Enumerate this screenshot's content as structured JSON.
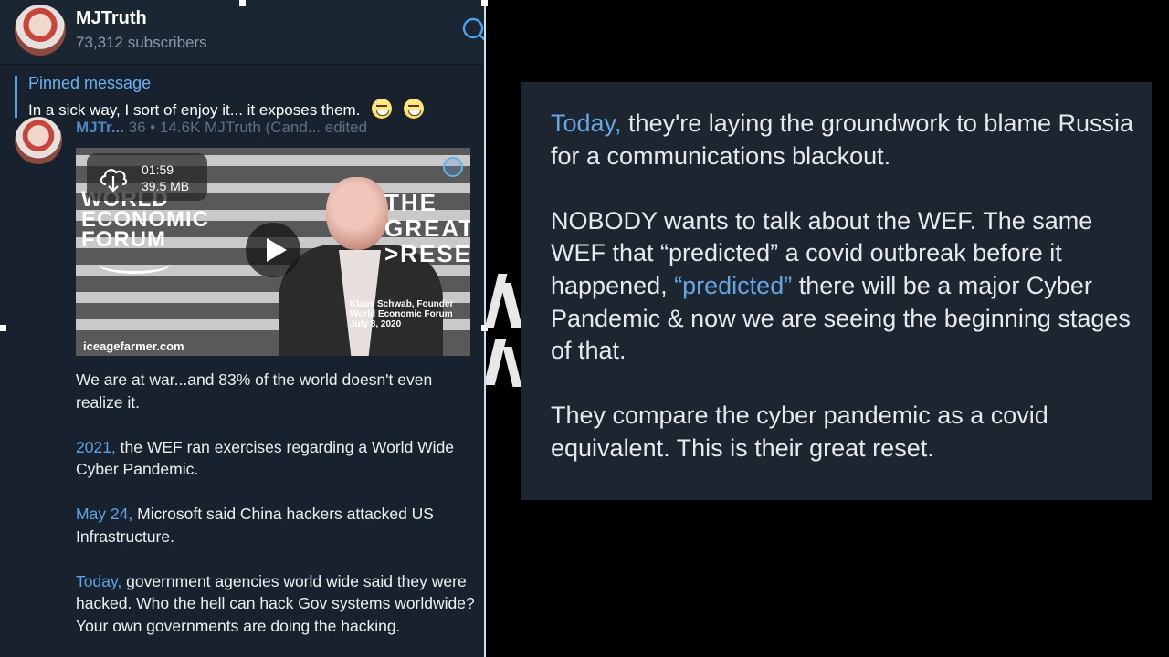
{
  "header": {
    "channel_name": "MJTruth",
    "subscribers": "73,312 subscribers",
    "icon": "search-icon"
  },
  "pinned": {
    "title": "Pinned message",
    "text": "In a sick way, I sort of enjoy it... it exposes them."
  },
  "post": {
    "meta_author": "MJTr...",
    "meta_rest": "36  •  14.6K MJTruth (Cand... edited",
    "video": {
      "duration": "01:59",
      "size": "39.5 MB",
      "logo_lines": [
        "WORLD",
        "ECONOMIC",
        "FORUM"
      ],
      "title_lines": [
        "THE",
        "GREAT",
        ">RESET"
      ],
      "caption_lines": [
        "Klaus Schwab, Founder",
        "World Economic Forum",
        "July 8, 2020"
      ],
      "watermark": "iceagefarmer.com"
    },
    "paragraphs": [
      {
        "highlight": "",
        "text": "We are at war...and 83% of the world doesn't even realize it."
      },
      {
        "highlight": "2021,",
        "text": " the WEF ran exercises regarding a World Wide Cyber Pandemic."
      },
      {
        "highlight": "May 24,",
        "text": " Microsoft said China hackers attacked US Infrastructure."
      },
      {
        "highlight": "Today,",
        "text": " government agencies world wide said they were hacked. Who the hell can hack Gov systems worldwide? Your own governments are doing the hacking."
      }
    ]
  },
  "slide": {
    "p1_highlight": "Today,",
    "p1_text": " they're laying the groundwork to blame Russia for a communications blackout.",
    "p2_before": "NOBODY wants to talk about the WEF. The same WEF that “predicted” a covid outbreak before it happened, ",
    "p2_highlight": "“predicted”",
    "p2_after": " there will be a major Cyber Pandemic & now we are seeing the beginning stages of that.",
    "p3_text": "They compare the cyber pandemic as a covid equivalent. This is their great reset."
  },
  "colors": {
    "panel_bg": "#18222e",
    "accent_link": "#5ea2e2",
    "slide_bg": "#1c2530"
  }
}
